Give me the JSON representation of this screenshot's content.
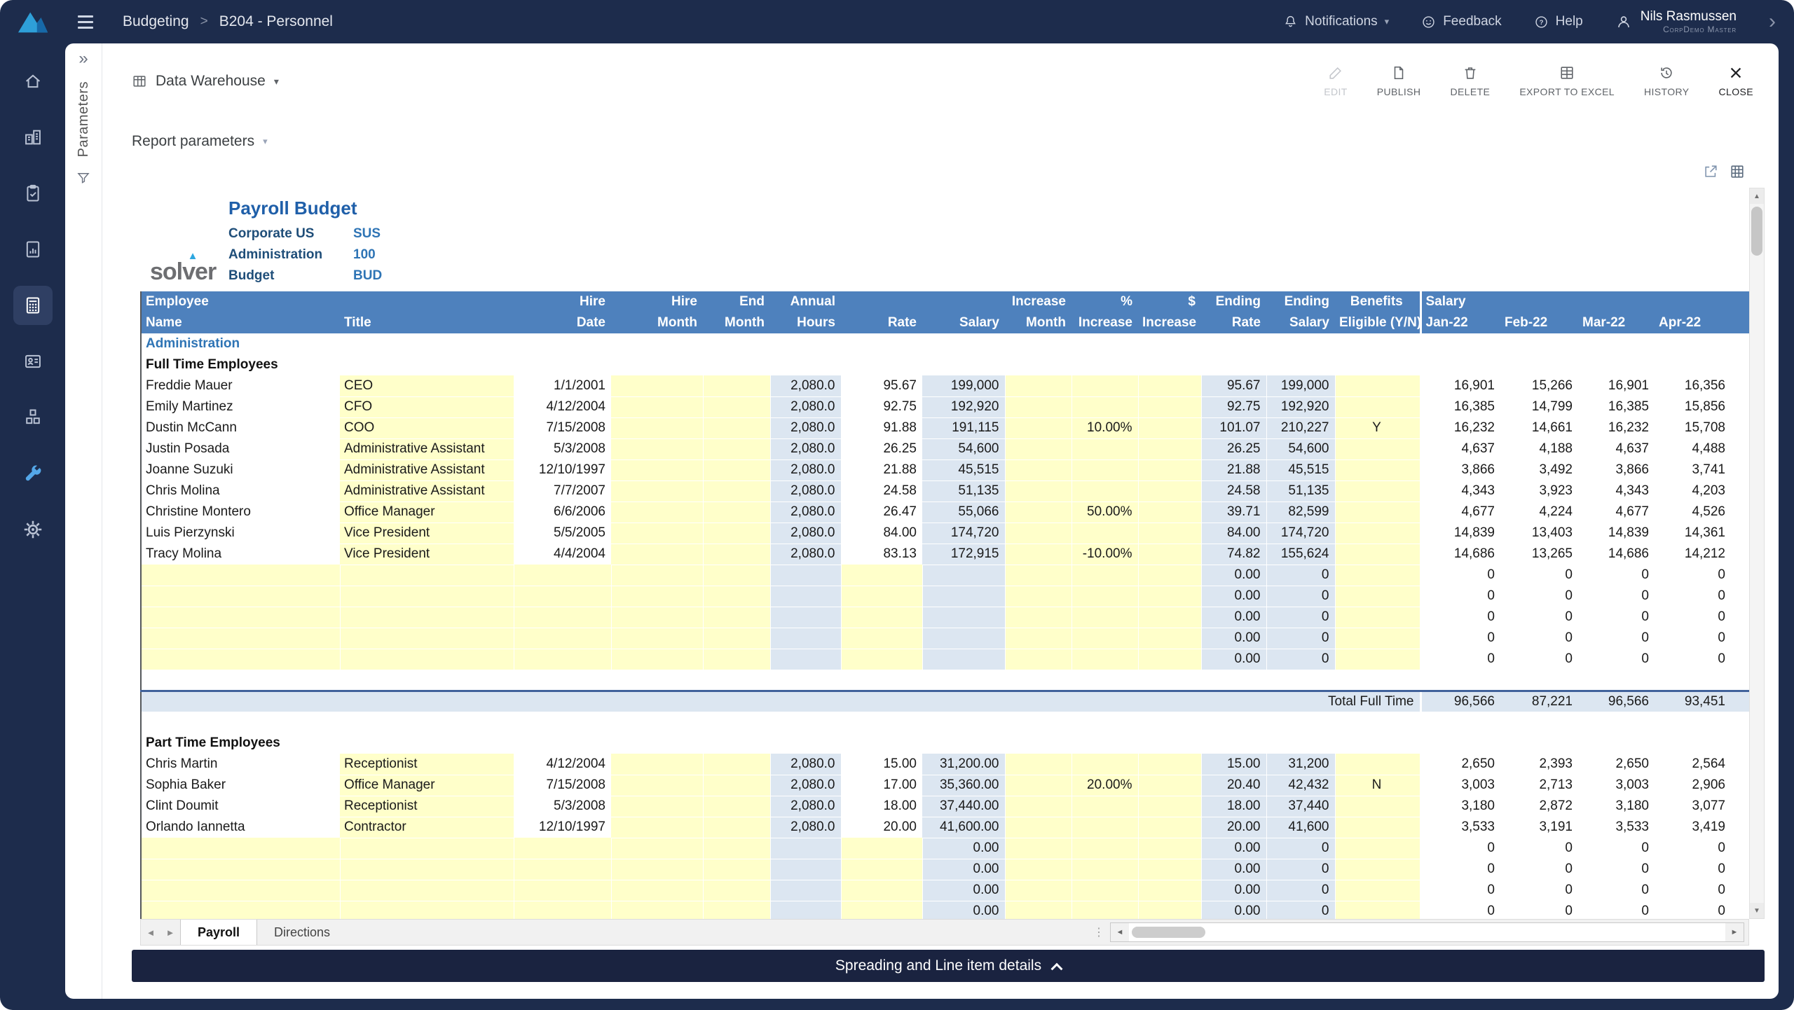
{
  "icons": {
    "caret_down": "▾",
    "collapse_left": "»",
    "chevron_right": "›",
    "breadcrumb_sep": ">",
    "tab_prev": "◄",
    "tab_next": "►",
    "scroll_up": "▲",
    "scroll_down": "▼",
    "scroll_left": "◄",
    "scroll_right": "►",
    "splitter": "⋮"
  },
  "colors": {
    "navy": "#1d2c4c",
    "header_blue": "#4e81bd",
    "input_yellow": "#ffffca",
    "calc_blue": "#dce6f1",
    "accent_blue": "#2e74b5"
  },
  "topbar": {
    "breadcrumb": [
      "Budgeting",
      "B204 - Personnel"
    ],
    "notifications_label": "Notifications",
    "feedback_label": "Feedback",
    "help_label": "Help",
    "user": {
      "name": "Nils Rasmussen",
      "org": "CorpDemo Master"
    }
  },
  "toolbar": {
    "context_label": "Data Warehouse",
    "actions": [
      "EDIT",
      "PUBLISH",
      "DELETE",
      "EXPORT TO EXCEL",
      "HISTORY",
      "CLOSE"
    ]
  },
  "parameters_panel": {
    "label": "Parameters"
  },
  "report_parameters_label": "Report parameters",
  "report": {
    "logo_text": "solver",
    "title": "Payroll Budget",
    "meta": [
      {
        "label": "Corporate US",
        "value": "SUS"
      },
      {
        "label": "Administration",
        "value": "100"
      },
      {
        "label": "Budget",
        "value": "BUD"
      }
    ],
    "table": {
      "group_label": "Administration",
      "header_top": [
        "Employee",
        "",
        "Hire",
        "Hire",
        "End",
        "Annual",
        "",
        "",
        "Increase",
        "%",
        "$",
        "Ending",
        "Ending",
        "Benefits",
        "Salary",
        "",
        "",
        ""
      ],
      "header_bottom": [
        "Name",
        "Title",
        "Date",
        "Month",
        "Month",
        "Hours",
        "Rate",
        "Salary",
        "Month",
        "Increase",
        "Increase",
        "Rate",
        "Salary",
        "Eligible (Y/N)",
        "Jan-22",
        "Feb-22",
        "Mar-22",
        "Apr-22"
      ],
      "sections": [
        {
          "label": "Full Time Employees",
          "rows": [
            [
              "Freddie Mauer",
              "CEO",
              "1/1/2001",
              "",
              "",
              "2,080.0",
              "95.67",
              "199,000",
              "",
              "",
              "",
              "95.67",
              "199,000",
              "",
              "16,901",
              "15,266",
              "16,901",
              "16,356"
            ],
            [
              "Emily Martinez",
              "CFO",
              "4/12/2004",
              "",
              "",
              "2,080.0",
              "92.75",
              "192,920",
              "",
              "",
              "",
              "92.75",
              "192,920",
              "",
              "16,385",
              "14,799",
              "16,385",
              "15,856"
            ],
            [
              "Dustin McCann",
              "COO",
              "7/15/2008",
              "",
              "",
              "2,080.0",
              "91.88",
              "191,115",
              "",
              "10.00%",
              "",
              "101.07",
              "210,227",
              "Y",
              "16,232",
              "14,661",
              "16,232",
              "15,708"
            ],
            [
              "Justin Posada",
              "Administrative Assistant",
              "5/3/2008",
              "",
              "",
              "2,080.0",
              "26.25",
              "54,600",
              "",
              "",
              "",
              "26.25",
              "54,600",
              "",
              "4,637",
              "4,188",
              "4,637",
              "4,488"
            ],
            [
              "Joanne Suzuki",
              "Administrative Assistant",
              "12/10/1997",
              "",
              "",
              "2,080.0",
              "21.88",
              "45,515",
              "",
              "",
              "",
              "21.88",
              "45,515",
              "",
              "3,866",
              "3,492",
              "3,866",
              "3,741"
            ],
            [
              "Chris Molina",
              "Administrative Assistant",
              "7/7/2007",
              "",
              "",
              "2,080.0",
              "24.58",
              "51,135",
              "",
              "",
              "",
              "24.58",
              "51,135",
              "",
              "4,343",
              "3,923",
              "4,343",
              "4,203"
            ],
            [
              "Christine Montero",
              "Office Manager",
              "6/6/2006",
              "",
              "",
              "2,080.0",
              "26.47",
              "55,066",
              "",
              "50.00%",
              "",
              "39.71",
              "82,599",
              "",
              "4,677",
              "4,224",
              "4,677",
              "4,526"
            ],
            [
              "Luis Pierzynski",
              "Vice President",
              "5/5/2005",
              "",
              "",
              "2,080.0",
              "84.00",
              "174,720",
              "",
              "",
              "",
              "84.00",
              "174,720",
              "",
              "14,839",
              "13,403",
              "14,839",
              "14,361"
            ],
            [
              "Tracy Molina",
              "Vice President",
              "4/4/2004",
              "",
              "",
              "2,080.0",
              "83.13",
              "172,915",
              "",
              "-10.00%",
              "",
              "74.82",
              "155,624",
              "",
              "14,686",
              "13,265",
              "14,686",
              "14,212"
            ]
          ],
          "empty_rows": 5,
          "empty_row": [
            "",
            "",
            "",
            "",
            "",
            "",
            "",
            "",
            "",
            "",
            "",
            "0.00",
            "0",
            "",
            "0",
            "0",
            "0",
            "0"
          ],
          "total_label": "Total Full Time",
          "total_values": [
            "96,566",
            "87,221",
            "96,566",
            "93,451"
          ]
        },
        {
          "label": "Part Time Employees",
          "rows": [
            [
              "Chris Martin",
              "Receptionist",
              "4/12/2004",
              "",
              "",
              "2,080.0",
              "15.00",
              "31,200.00",
              "",
              "",
              "",
              "15.00",
              "31,200",
              "",
              "2,650",
              "2,393",
              "2,650",
              "2,564"
            ],
            [
              "Sophia Baker",
              "Office Manager",
              "7/15/2008",
              "",
              "",
              "2,080.0",
              "17.00",
              "35,360.00",
              "",
              "20.00%",
              "",
              "20.40",
              "42,432",
              "N",
              "3,003",
              "2,713",
              "3,003",
              "2,906"
            ],
            [
              "Clint Doumit",
              "Receptionist",
              "5/3/2008",
              "",
              "",
              "2,080.0",
              "18.00",
              "37,440.00",
              "",
              "",
              "",
              "18.00",
              "37,440",
              "",
              "3,180",
              "2,872",
              "3,180",
              "3,077"
            ],
            [
              "Orlando Iannetta",
              "Contractor",
              "12/10/1997",
              "",
              "",
              "2,080.0",
              "20.00",
              "41,600.00",
              "",
              "",
              "",
              "20.00",
              "41,600",
              "",
              "3,533",
              "3,191",
              "3,533",
              "3,419"
            ]
          ],
          "empty_rows": 5,
          "empty_row": [
            "",
            "",
            "",
            "",
            "",
            "",
            "",
            "0.00",
            "",
            "",
            "",
            "0.00",
            "0",
            "",
            "0",
            "0",
            "0",
            "0"
          ]
        }
      ]
    },
    "tabs": [
      "Payroll",
      "Directions"
    ]
  },
  "footer": {
    "label": "Spreading and Line item details"
  }
}
